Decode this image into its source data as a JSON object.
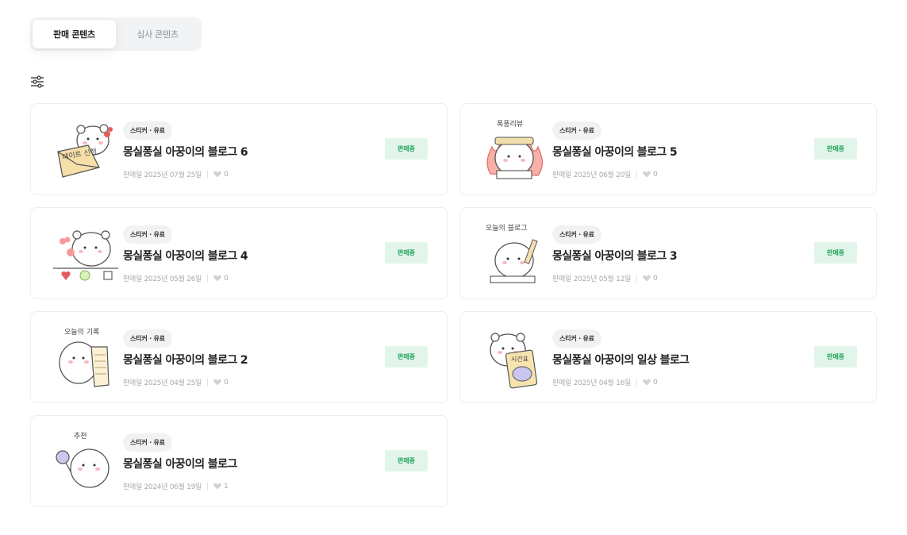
{
  "tabs": [
    {
      "label": "판매 콘텐츠",
      "active": true
    },
    {
      "label": "심사 콘텐츠",
      "active": false
    }
  ],
  "filter_icon": "sliders-icon",
  "colors": {
    "status_bg": "#e2f5ea",
    "status_text": "#21a55d",
    "tag_bg": "#f1f2f4"
  },
  "items": [
    {
      "tag": "스티커 · 유료",
      "title": "몽실퐁실 아꿍이의 블로그 6",
      "date": "판매일 2025년 07월 25일",
      "likes": "0",
      "status": "판매중",
      "thumb_caption": "데이트 신청"
    },
    {
      "tag": "스티커 · 유료",
      "title": "몽실퐁실 아꿍이의 블로그 5",
      "date": "판매일 2025년 06월 20일",
      "likes": "0",
      "status": "판매중",
      "thumb_caption": "폭풍리뷰"
    },
    {
      "tag": "스티커 · 유료",
      "title": "몽실퐁실 아꿍이의 블로그 4",
      "date": "판매일 2025년 05월 26일",
      "likes": "0",
      "status": "판매중",
      "thumb_caption": ""
    },
    {
      "tag": "스티커 · 유료",
      "title": "몽실퐁실 아꿍이의 블로그 3",
      "date": "판매일 2025년 05월 12일",
      "likes": "0",
      "status": "판매중",
      "thumb_caption": "오늘의 블로그"
    },
    {
      "tag": "스티커 · 유료",
      "title": "몽실퐁실 아꿍이의 블로그 2",
      "date": "판매일 2025년 04월 25일",
      "likes": "0",
      "status": "판매중",
      "thumb_caption": "오늘의 기록"
    },
    {
      "tag": "스티커 · 유료",
      "title": "몽실퐁실 아꿍이의 일상 블로그",
      "date": "판매일 2025년 04월 16일",
      "likes": "0",
      "status": "판매중",
      "thumb_caption": "시간표"
    },
    {
      "tag": "스티커 · 유료",
      "title": "몽실퐁실 아꿍이의 블로그",
      "date": "판매일 2024년 06월 19일",
      "likes": "1",
      "status": "판매중",
      "thumb_caption": "추천"
    }
  ]
}
